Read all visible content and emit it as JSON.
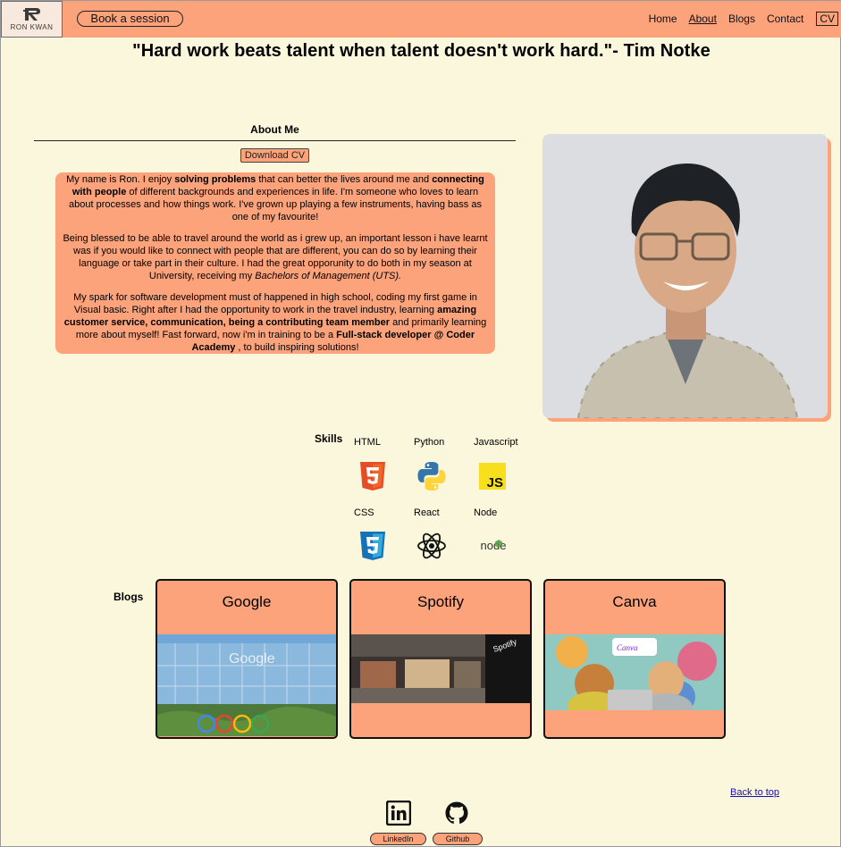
{
  "nav": {
    "logo_text": "RON KWAN",
    "book_label": "Book a session",
    "links": [
      "Home",
      "About",
      "Blogs",
      "Contact"
    ],
    "active_link": "About",
    "cv_label": "CV"
  },
  "quote": "\"Hard work beats talent when talent doesn't work hard.\"- Tim Notke",
  "about": {
    "title": "About Me",
    "download_label": "Download CV",
    "p1_a": "My name is Ron. I enjoy ",
    "p1_b": "solving problems",
    "p1_c": " that can better the lives around me and ",
    "p1_d": "connecting with people",
    "p1_e": " of different backgrounds and experiences in life. I'm someone who loves to learn about processes and how things work. I've grown up playing a few instruments, having bass as one of my favourite!",
    "p2_a": "Being blessed to be able to travel around the world as i grew up, an important lesson i have learnt was if you would like to connect with people that are different, you can do so by learning their language or take part in their culture. I had the great opporunity to do both in my season at University, receiving my ",
    "p2_b": "Bachelors of Management (UTS).",
    "p3_a": "My spark for software development must of happened in high school, coding my first game in Visual basic. Right after I had the opportunity to work in the travel industry, learning ",
    "p3_b": "amazing customer service, communication, being a contributing team member",
    "p3_c": " and primarily learning more about myself! Fast forward, now i'm in training to be a ",
    "p3_d": "Full-stack developer @ Coder Academy",
    "p3_e": " , to build inspiring solutions!"
  },
  "skills": {
    "label": "Skills",
    "items": [
      {
        "name": "HTML",
        "icon": "html5-icon",
        "color": "#e44d26"
      },
      {
        "name": "Python",
        "icon": "python-icon",
        "color": "#3776ab"
      },
      {
        "name": "Javascript",
        "icon": "javascript-icon",
        "color": "#f7df1e"
      },
      {
        "name": "CSS",
        "icon": "css3-icon",
        "color": "#1572b6"
      },
      {
        "name": "React",
        "icon": "react-icon",
        "color": "#111111"
      },
      {
        "name": "Node",
        "icon": "nodejs-icon",
        "color": "#539e43"
      }
    ]
  },
  "blogs": {
    "label": "Blogs",
    "cards": [
      "Google",
      "Spotify",
      "Canva"
    ]
  },
  "footer": {
    "back_to_top": "Back to top",
    "linkedin_label": "LinkedIn",
    "github_label": "Github"
  },
  "colors": {
    "accent": "#fca37c",
    "background": "#fbf7dc"
  }
}
